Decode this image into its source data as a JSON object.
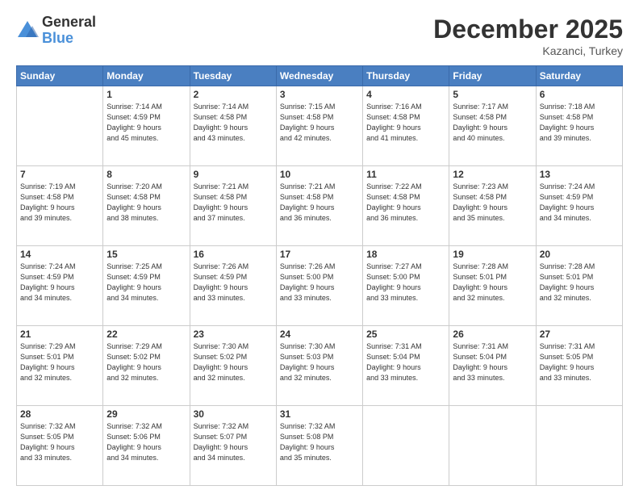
{
  "logo": {
    "general": "General",
    "blue": "Blue"
  },
  "title": {
    "month": "December 2025",
    "location": "Kazanci, Turkey"
  },
  "days_of_week": [
    "Sunday",
    "Monday",
    "Tuesday",
    "Wednesday",
    "Thursday",
    "Friday",
    "Saturday"
  ],
  "weeks": [
    [
      {
        "num": "",
        "info": ""
      },
      {
        "num": "1",
        "info": "Sunrise: 7:14 AM\nSunset: 4:59 PM\nDaylight: 9 hours\nand 45 minutes."
      },
      {
        "num": "2",
        "info": "Sunrise: 7:14 AM\nSunset: 4:58 PM\nDaylight: 9 hours\nand 43 minutes."
      },
      {
        "num": "3",
        "info": "Sunrise: 7:15 AM\nSunset: 4:58 PM\nDaylight: 9 hours\nand 42 minutes."
      },
      {
        "num": "4",
        "info": "Sunrise: 7:16 AM\nSunset: 4:58 PM\nDaylight: 9 hours\nand 41 minutes."
      },
      {
        "num": "5",
        "info": "Sunrise: 7:17 AM\nSunset: 4:58 PM\nDaylight: 9 hours\nand 40 minutes."
      },
      {
        "num": "6",
        "info": "Sunrise: 7:18 AM\nSunset: 4:58 PM\nDaylight: 9 hours\nand 39 minutes."
      }
    ],
    [
      {
        "num": "7",
        "info": "Sunrise: 7:19 AM\nSunset: 4:58 PM\nDaylight: 9 hours\nand 39 minutes."
      },
      {
        "num": "8",
        "info": "Sunrise: 7:20 AM\nSunset: 4:58 PM\nDaylight: 9 hours\nand 38 minutes."
      },
      {
        "num": "9",
        "info": "Sunrise: 7:21 AM\nSunset: 4:58 PM\nDaylight: 9 hours\nand 37 minutes."
      },
      {
        "num": "10",
        "info": "Sunrise: 7:21 AM\nSunset: 4:58 PM\nDaylight: 9 hours\nand 36 minutes."
      },
      {
        "num": "11",
        "info": "Sunrise: 7:22 AM\nSunset: 4:58 PM\nDaylight: 9 hours\nand 36 minutes."
      },
      {
        "num": "12",
        "info": "Sunrise: 7:23 AM\nSunset: 4:58 PM\nDaylight: 9 hours\nand 35 minutes."
      },
      {
        "num": "13",
        "info": "Sunrise: 7:24 AM\nSunset: 4:59 PM\nDaylight: 9 hours\nand 34 minutes."
      }
    ],
    [
      {
        "num": "14",
        "info": "Sunrise: 7:24 AM\nSunset: 4:59 PM\nDaylight: 9 hours\nand 34 minutes."
      },
      {
        "num": "15",
        "info": "Sunrise: 7:25 AM\nSunset: 4:59 PM\nDaylight: 9 hours\nand 34 minutes."
      },
      {
        "num": "16",
        "info": "Sunrise: 7:26 AM\nSunset: 4:59 PM\nDaylight: 9 hours\nand 33 minutes."
      },
      {
        "num": "17",
        "info": "Sunrise: 7:26 AM\nSunset: 5:00 PM\nDaylight: 9 hours\nand 33 minutes."
      },
      {
        "num": "18",
        "info": "Sunrise: 7:27 AM\nSunset: 5:00 PM\nDaylight: 9 hours\nand 33 minutes."
      },
      {
        "num": "19",
        "info": "Sunrise: 7:28 AM\nSunset: 5:01 PM\nDaylight: 9 hours\nand 32 minutes."
      },
      {
        "num": "20",
        "info": "Sunrise: 7:28 AM\nSunset: 5:01 PM\nDaylight: 9 hours\nand 32 minutes."
      }
    ],
    [
      {
        "num": "21",
        "info": "Sunrise: 7:29 AM\nSunset: 5:01 PM\nDaylight: 9 hours\nand 32 minutes."
      },
      {
        "num": "22",
        "info": "Sunrise: 7:29 AM\nSunset: 5:02 PM\nDaylight: 9 hours\nand 32 minutes."
      },
      {
        "num": "23",
        "info": "Sunrise: 7:30 AM\nSunset: 5:02 PM\nDaylight: 9 hours\nand 32 minutes."
      },
      {
        "num": "24",
        "info": "Sunrise: 7:30 AM\nSunset: 5:03 PM\nDaylight: 9 hours\nand 32 minutes."
      },
      {
        "num": "25",
        "info": "Sunrise: 7:31 AM\nSunset: 5:04 PM\nDaylight: 9 hours\nand 33 minutes."
      },
      {
        "num": "26",
        "info": "Sunrise: 7:31 AM\nSunset: 5:04 PM\nDaylight: 9 hours\nand 33 minutes."
      },
      {
        "num": "27",
        "info": "Sunrise: 7:31 AM\nSunset: 5:05 PM\nDaylight: 9 hours\nand 33 minutes."
      }
    ],
    [
      {
        "num": "28",
        "info": "Sunrise: 7:32 AM\nSunset: 5:05 PM\nDaylight: 9 hours\nand 33 minutes."
      },
      {
        "num": "29",
        "info": "Sunrise: 7:32 AM\nSunset: 5:06 PM\nDaylight: 9 hours\nand 34 minutes."
      },
      {
        "num": "30",
        "info": "Sunrise: 7:32 AM\nSunset: 5:07 PM\nDaylight: 9 hours\nand 34 minutes."
      },
      {
        "num": "31",
        "info": "Sunrise: 7:32 AM\nSunset: 5:08 PM\nDaylight: 9 hours\nand 35 minutes."
      },
      {
        "num": "",
        "info": ""
      },
      {
        "num": "",
        "info": ""
      },
      {
        "num": "",
        "info": ""
      }
    ]
  ]
}
